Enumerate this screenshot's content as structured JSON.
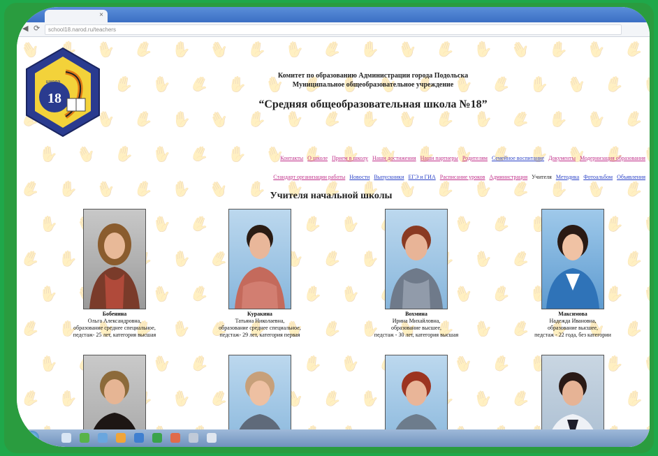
{
  "browser": {
    "tab_label": "",
    "tab_close": "×",
    "url": "school18.narod.ru/teachers",
    "back_icon": "◀",
    "reload_icon": "⟳"
  },
  "header": {
    "line1": "Комитет по образованию Администрации города Подольска",
    "line2": "Муниципальное общеобразовательное учреждение",
    "title": "“Средняя общеобразовательная школа №18”",
    "logo_number": "18",
    "logo_text": "школа"
  },
  "menu": {
    "row1": [
      {
        "label": "Контакты",
        "color": "pink"
      },
      {
        "label": "О школе",
        "color": "pink"
      },
      {
        "label": "Прием в школу",
        "color": "pink"
      },
      {
        "label": "Наши достижения",
        "color": "pink"
      },
      {
        "label": "Наши партнеры",
        "color": "pink"
      },
      {
        "label": "Родителям",
        "color": "pink"
      },
      {
        "label": "Семейное воспитание",
        "color": "blue"
      },
      {
        "label": "Документы",
        "color": "pink"
      },
      {
        "label": "Модернизация образования",
        "color": "pink"
      }
    ],
    "row2": [
      {
        "label": "Стандарт организации работы",
        "color": "pink"
      },
      {
        "label": "Новости",
        "color": "blue"
      },
      {
        "label": "Выпускники",
        "color": "blue"
      },
      {
        "label": "ЕГЭ и ГИА",
        "color": "blue"
      },
      {
        "label": "Расписание уроков",
        "color": "pink"
      },
      {
        "label": "Администрация",
        "color": "pink"
      },
      {
        "label": "Учителя",
        "color": "current"
      },
      {
        "label": "Методика",
        "color": "blue"
      },
      {
        "label": "Фотоальбом",
        "color": "blue"
      },
      {
        "label": "Объявления",
        "color": "blue"
      }
    ]
  },
  "section_title": "Учителя начальной школы",
  "teachers": [
    {
      "surname": "Бобенина",
      "name": "Ольга Александровна,",
      "edu": "образование среднее специальное,",
      "exp": "педстаж- 25 лет, категория высшая"
    },
    {
      "surname": "Куракина",
      "name": "Татьяна Николаевна,",
      "edu": "образование среднее специальное,",
      "exp": "педстаж- 29 лет, категория первая"
    },
    {
      "surname": "Вохмина",
      "name": "Ирина Михайловна,",
      "edu": "образование высшее,",
      "exp": "педстаж - 30 лет, категория высшая"
    },
    {
      "surname": "Максимова",
      "name": "Надежда Ивановна,",
      "edu": "образование высшее,",
      "exp": "педстаж - 22 года, без категории"
    }
  ],
  "colors": {
    "pink_link": "#c0308a",
    "blue_link": "#2c43c8",
    "frame_green": "#1fa84a",
    "taskbar": "#7d9cc6"
  }
}
